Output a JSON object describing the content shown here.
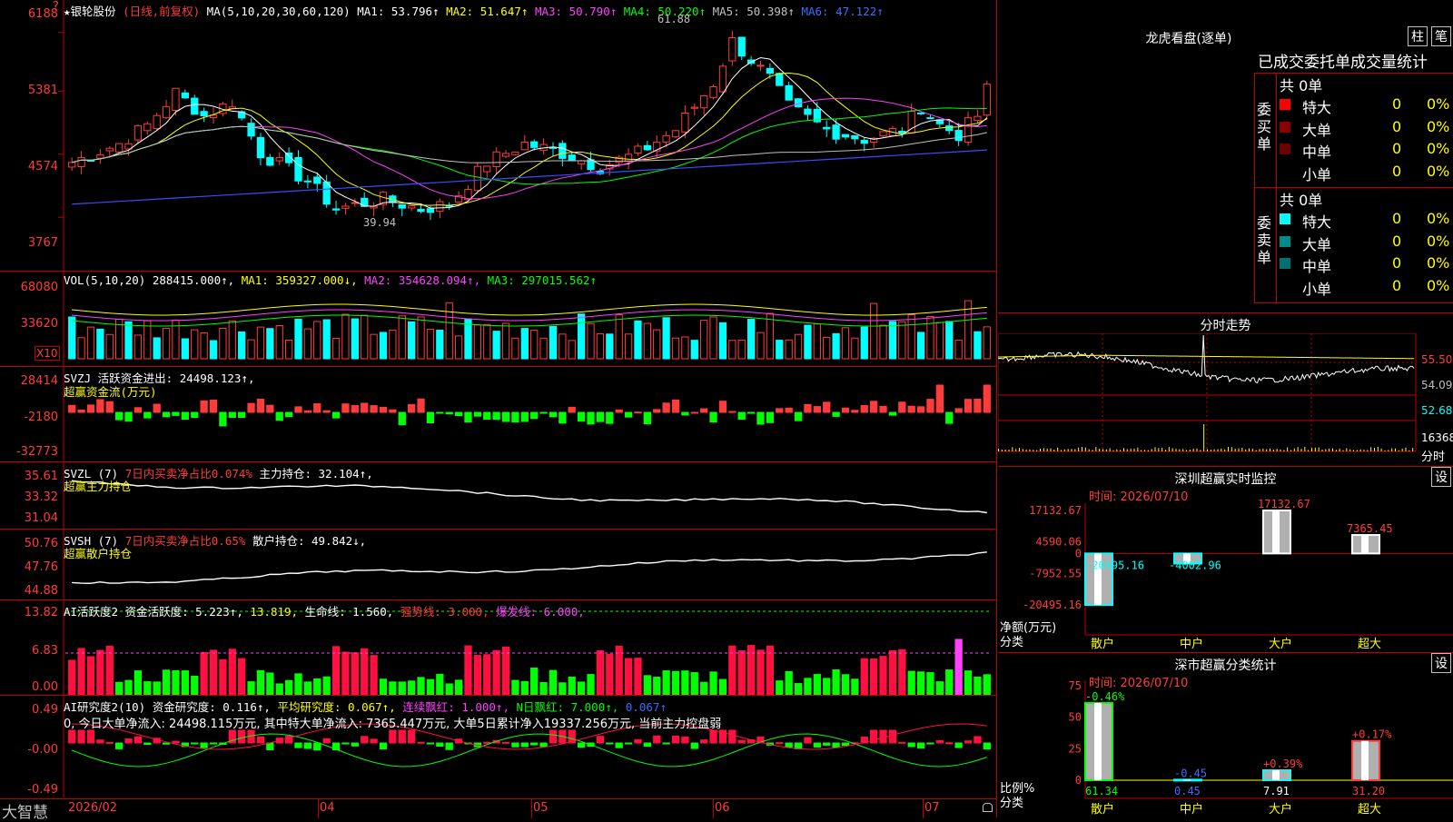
{
  "app": {
    "brand": "大智慧",
    "stock_marker": "?"
  },
  "kline": {
    "title": "★银轮股份",
    "mode": "(日线,前复权)",
    "ma_head": "MA(5,10,20,30,60,120)",
    "ma": [
      {
        "label": "MA1: 53.796↑",
        "color": "#ffffff"
      },
      {
        "label": "MA2: 51.647↑",
        "color": "#ffff00"
      },
      {
        "label": "MA3: 50.790↑",
        "color": "#ff40ff"
      },
      {
        "label": "MA4: 50.220↑",
        "color": "#00ff00"
      },
      {
        "label": "MA5: 50.398↑",
        "color": "#c0c0c0"
      },
      {
        "label": "MA6: 47.122↑",
        "color": "#3b6cff"
      }
    ],
    "high_note": "61.88",
    "low_note": "39.94",
    "axis": [
      "6188",
      "5381",
      "4574",
      "3767"
    ]
  },
  "vol": {
    "head": "VOL(5,10,20)",
    "value": "288415.000↑,",
    "ma1": "MA1: 359327.000↓,",
    "ma2": "MA2: 354628.094↑,",
    "ma3": "MA3: 297015.562↑",
    "axis": [
      "68080",
      "33620"
    ],
    "unit": "X10"
  },
  "svzj": {
    "head": "SVZJ",
    "line1": "活跃资金进出: 24498.123↑,",
    "line2": "超赢资金流(万元)",
    "axis": [
      "28414",
      "-2180",
      "-32773"
    ]
  },
  "svzl": {
    "head": "SVZL (7)",
    "pct": "7日内买卖净占比0.074%",
    "main": "主力持仓: 32.104↑,",
    "line2": "超赢主力持仓",
    "axis": [
      "35.61",
      "33.32",
      "31.04"
    ]
  },
  "svsh": {
    "head": "SVSH (7)",
    "pct": "7日内买卖净占比0.65%",
    "main": "散户持仓: 49.842↓,",
    "line2": "超赢散户持仓",
    "axis": [
      "50.76",
      "47.76",
      "44.88"
    ]
  },
  "ai1": {
    "head": "AI活跃度2",
    "p1": "资金活跃度: 5.223↑,",
    "p2": "13.819,",
    "p3": "生命线: 1.560,",
    "p4": "强势线: 3.000,",
    "p5": "爆发线: 6.000,",
    "axis": [
      "13.82",
      "6.83",
      "0.00"
    ]
  },
  "ai2": {
    "head": "AI研究度2(10)",
    "p1": "资金研究度: 0.116↑,",
    "p2": "平均研究度: 0.067↑,",
    "p3": "连续飘红: 1.000↑,",
    "p4": "N日飘红: 7.000↑,",
    "p5": "0.067↑",
    "note": "0, 今日大单净流入: 24498.115万元, 其中特大单净流入: 7365.447万元, 大单5日累计净入19337.256万元, 当前主力控盘弱",
    "axis": [
      "0.49",
      "-0.00",
      "-0.49"
    ]
  },
  "dates": [
    "2026/02",
    "04",
    "05",
    "06",
    "07"
  ],
  "lhb": {
    "title": "龙虎看盘(逐单)",
    "btn1": "柱",
    "btn2": "笔",
    "subtitle": "已成交委托单成交量统计",
    "buy_side": "委买单",
    "sell_side": "委卖单",
    "buy_total": "共 0单",
    "sell_total": "共 0单",
    "buy_rows": [
      {
        "name": "特大",
        "v": "0",
        "p": "0%",
        "c": "#ff0000"
      },
      {
        "name": "大单",
        "v": "0",
        "p": "0%",
        "c": "#8b0000"
      },
      {
        "name": "中单",
        "v": "0",
        "p": "0%",
        "c": "#6b0000"
      },
      {
        "name": "小单",
        "v": "0",
        "p": "0%",
        "c": "#000000"
      }
    ],
    "sell_rows": [
      {
        "name": "特大",
        "v": "0",
        "p": "0%",
        "c": "#00ffff"
      },
      {
        "name": "大单",
        "v": "0",
        "p": "0%",
        "c": "#008b8b"
      },
      {
        "name": "中单",
        "v": "0",
        "p": "0%",
        "c": "#007070"
      },
      {
        "name": "小单",
        "v": "0",
        "p": "0%",
        "c": "#000000"
      }
    ]
  },
  "fenshi": {
    "title": "分时走势",
    "axis": [
      "55.50",
      "54.09",
      "52.68",
      "16368",
      "分时"
    ]
  },
  "sz_monitor": {
    "title": "深圳超赢实时监控",
    "btn": "设",
    "time": "时间: 2026/07/10",
    "axis": [
      "17132.67",
      "4590.06",
      "0",
      "-7952.55",
      "-20495.16"
    ],
    "bars": [
      {
        "label": "散户",
        "v": "-20495.16"
      },
      {
        "label": "中户",
        "v": "-4002.96"
      },
      {
        "label": "大户",
        "v": "17132.67"
      },
      {
        "label": "超大",
        "v": "7365.45"
      }
    ],
    "ylabel1": "净额(万元)",
    "ylabel2": "分类"
  },
  "sz_class": {
    "title": "深市超赢分类统计",
    "btn": "设",
    "time": "时间: 2026/07/10",
    "axis": [
      "75",
      "50",
      "25",
      "0"
    ],
    "bars": [
      {
        "label": "散户",
        "v": "61.34",
        "chg": "-0.46%"
      },
      {
        "label": "中户",
        "v": "0.45",
        "chg": "-0.45"
      },
      {
        "label": "大户",
        "v": "7.91",
        "chg": "+0.39%"
      },
      {
        "label": "超大",
        "v": "31.20",
        "chg": "+0.17%"
      }
    ],
    "ylabel1": "比例%",
    "ylabel2": "分类"
  },
  "chart_data": [
    {
      "type": "candlestick",
      "title": "★银轮股份 (日线,前复权)",
      "ylim": [
        37.67,
        61.88
      ],
      "high": 61.88,
      "low": 39.94,
      "series": [
        {
          "name": "MA1",
          "value": 53.796
        },
        {
          "name": "MA2",
          "value": 51.647
        },
        {
          "name": "MA3",
          "value": 50.79
        },
        {
          "name": "MA4",
          "value": 50.22
        },
        {
          "name": "MA5",
          "value": 50.398
        },
        {
          "name": "MA6",
          "value": 47.122
        }
      ]
    },
    {
      "type": "bar",
      "title": "VOL(5,10,20)",
      "value": 288415.0,
      "ma": [
        359327.0,
        354628.094,
        297015.562
      ]
    },
    {
      "type": "bar",
      "title": "深圳超赢实时监控",
      "categories": [
        "散户",
        "中户",
        "大户",
        "超大"
      ],
      "values": [
        -20495.16,
        -4002.96,
        17132.67,
        7365.45
      ],
      "ylim": [
        -20495.16,
        17132.67
      ]
    },
    {
      "type": "bar",
      "title": "深市超赢分类统计",
      "categories": [
        "散户",
        "中户",
        "大户",
        "超大"
      ],
      "values": [
        61.34,
        0.45,
        7.91,
        31.2
      ],
      "ylim": [
        0,
        75
      ]
    }
  ]
}
